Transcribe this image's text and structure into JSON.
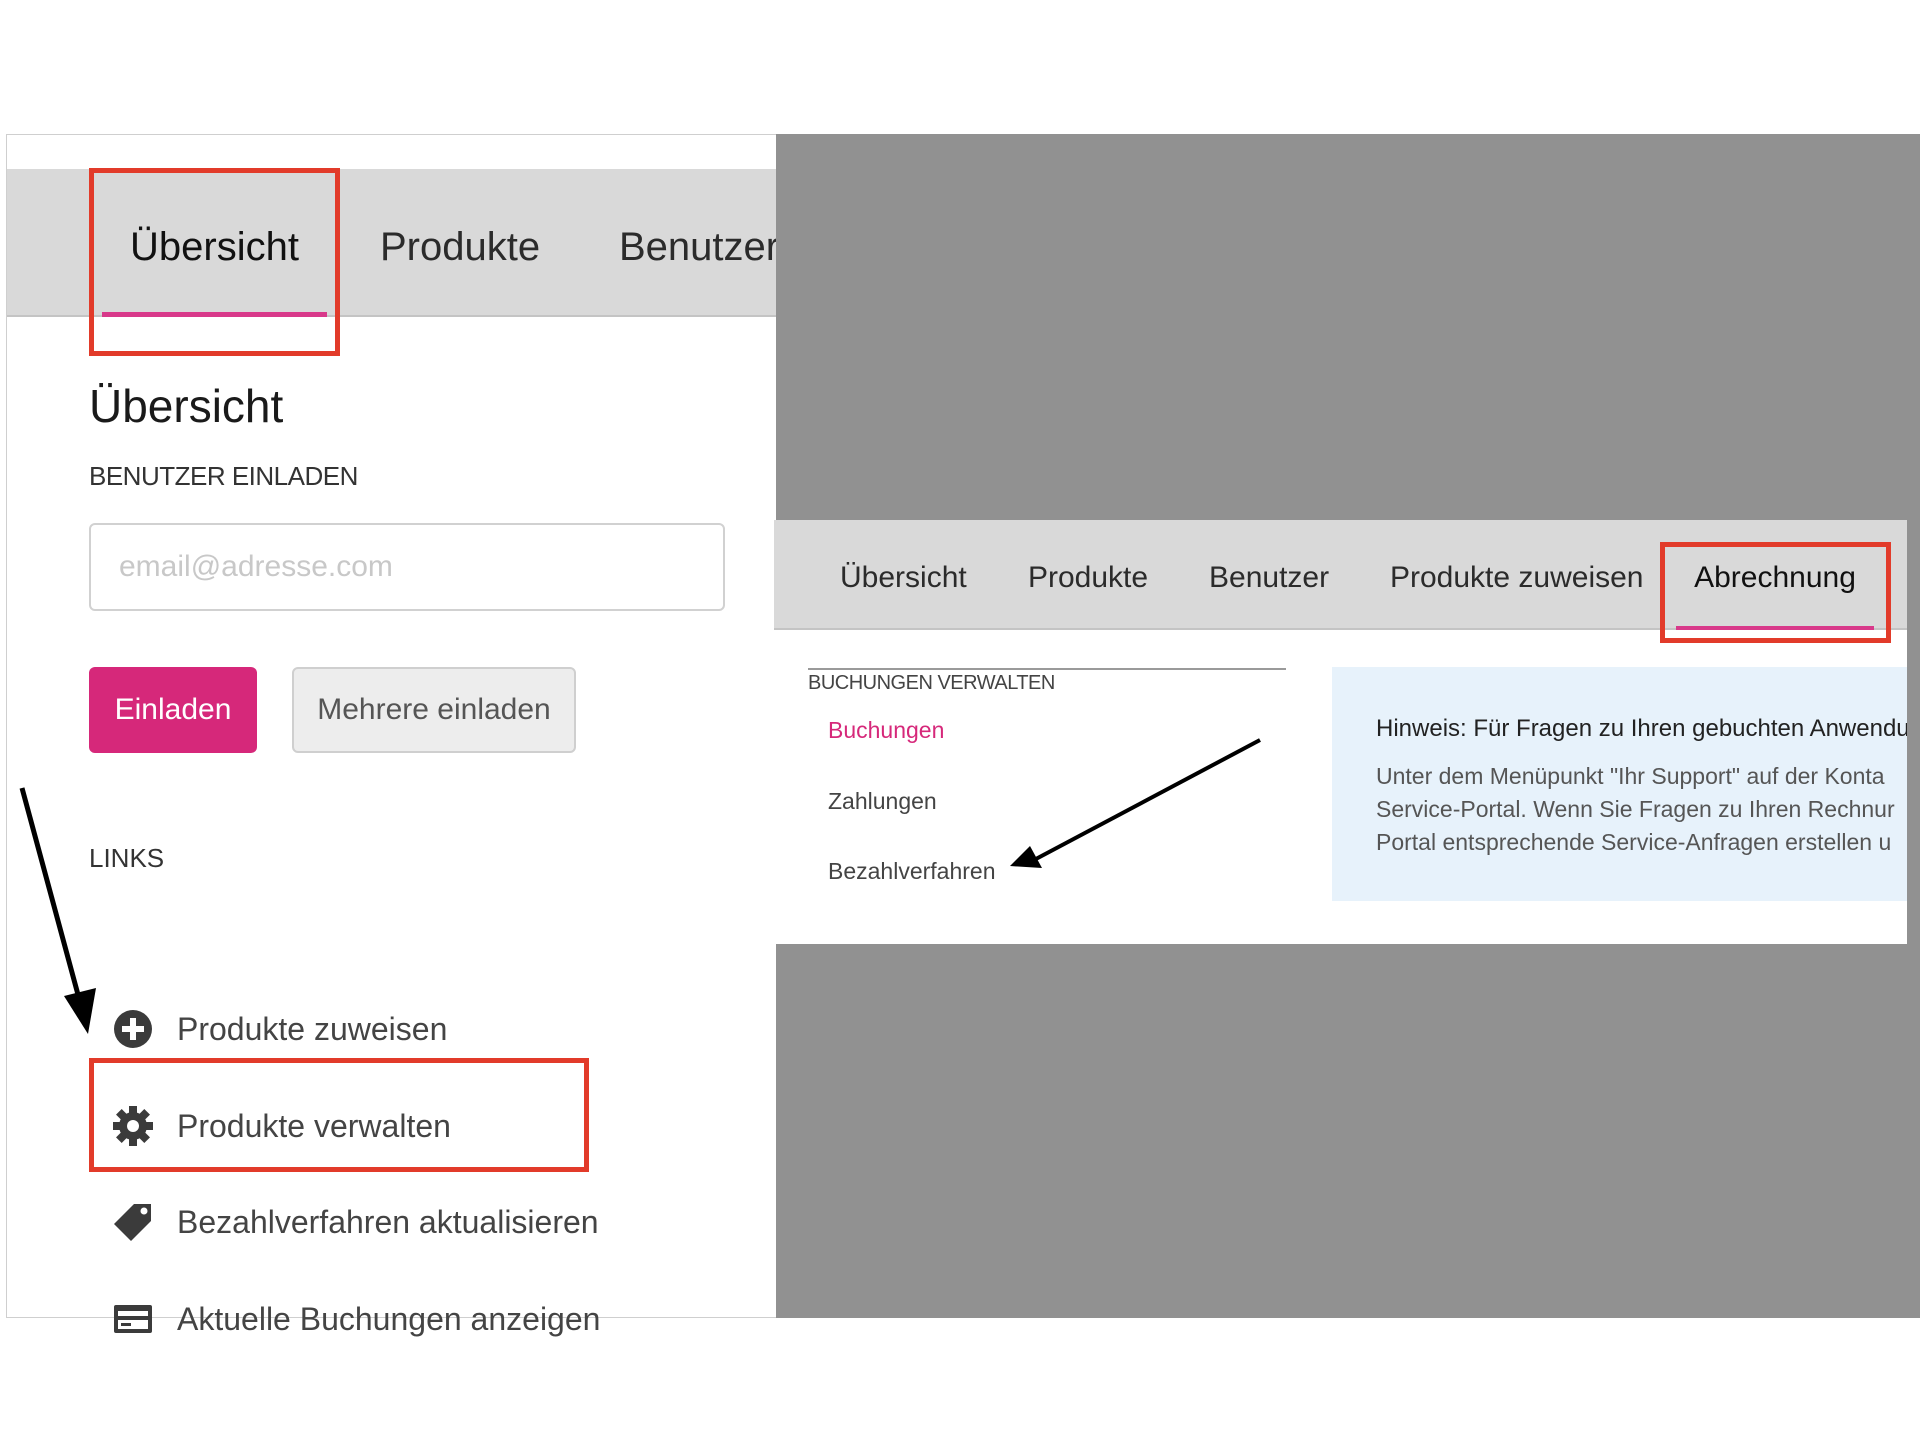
{
  "left_panel": {
    "tabs": [
      {
        "label": "Übersicht",
        "active": true
      },
      {
        "label": "Produkte",
        "active": false
      },
      {
        "label": "Benutzer",
        "active": false
      }
    ],
    "page_title": "Übersicht",
    "invite_section_label": "BENUTZER EINLADEN",
    "email_input": {
      "value": "",
      "placeholder": "email@adresse.com"
    },
    "invite_button_label": "Einladen",
    "invite_multiple_button_label": "Mehrere einladen",
    "links_label": "LINKS",
    "links": [
      {
        "label": "Produkte zuweisen",
        "icon": "plus-circle-icon"
      },
      {
        "label": "Produkte verwalten",
        "icon": "gear-icon"
      },
      {
        "label": "Bezahlverfahren aktualisieren",
        "icon": "tag-icon"
      },
      {
        "label": "Aktuelle Buchungen anzeigen",
        "icon": "credit-card-icon"
      }
    ]
  },
  "right_panel": {
    "tabs": [
      {
        "label": "Übersicht",
        "active": false
      },
      {
        "label": "Produkte",
        "active": false
      },
      {
        "label": "Benutzer",
        "active": false
      },
      {
        "label": "Produkte zuweisen",
        "active": false
      },
      {
        "label": "Abrechnung",
        "active": true
      }
    ],
    "side_heading": "BUCHUNGEN VERWALTEN",
    "side_links": [
      {
        "label": "Buchungen",
        "active": true
      },
      {
        "label": "Zahlungen",
        "active": false
      },
      {
        "label": "Bezahlverfahren",
        "active": false
      }
    ],
    "hint": {
      "title": "Hinweis: Für Fragen zu Ihren gebuchten Anwendu",
      "lines": [
        "Unter dem Menüpunkt \"Ihr Support\" auf der Konta",
        "Service-Portal. Wenn Sie Fragen zu Ihren Rechnur",
        "Portal entsprechende Service-Anfragen erstellen u"
      ]
    }
  },
  "colors": {
    "accent_magenta": "#d6287a",
    "highlight_red": "#e23b2a",
    "tab_bar_gray": "#d9d9d9",
    "overlay_gray": "#919191",
    "hint_background": "#e7f2fb"
  }
}
